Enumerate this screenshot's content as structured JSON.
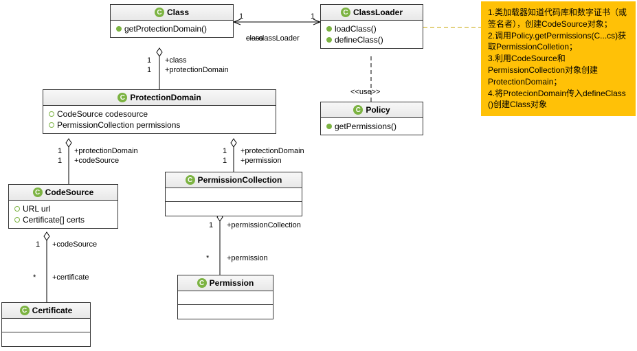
{
  "classes": {
    "class": {
      "name": "Class",
      "ops": [
        "getProtectionDomain()"
      ]
    },
    "classLoader": {
      "name": "ClassLoader",
      "ops": [
        "loadClass()",
        "defineClass()"
      ]
    },
    "protectionDomain": {
      "name": "ProtectionDomain",
      "attrs": [
        "CodeSource codesource",
        "PermissionCollection permissions"
      ]
    },
    "policy": {
      "name": "Policy",
      "ops": [
        "getPermissions()"
      ]
    },
    "codeSource": {
      "name": "CodeSource",
      "attrs": [
        "URL url",
        "Certificate[] certs"
      ]
    },
    "permissionCollection": {
      "name": "PermissionCollection"
    },
    "certificate": {
      "name": "Certificate"
    },
    "permission": {
      "name": "Permission"
    }
  },
  "assoc": {
    "class_cl_left_mult": "1",
    "class_cl_right_mult": "1",
    "class_cl_role": "+classLoader",
    "class_pd_top1": "1",
    "class_pd_top2": "1",
    "class_pd_role1": "+class",
    "class_pd_role2": "+protectionDomain",
    "pd_cs_top1": "1",
    "pd_cs_top2": "1",
    "pd_cs_role1": "+protectionDomain",
    "pd_cs_role2": "+codeSource",
    "pd_pc_top1": "1",
    "pd_pc_top2": "1",
    "pd_pc_role1": "+protectionDomain",
    "pd_pc_role2": "+permission",
    "cs_cert_top": "1",
    "cs_cert_role1": "+codeSource",
    "cs_cert_star": "*",
    "cs_cert_role2": "+certificate",
    "pc_perm_top": "1",
    "pc_perm_role1": "+permissionCollection",
    "pc_perm_star": "*",
    "pc_perm_role2": "+permission",
    "use_label": "<<use>>",
    "class_both": "class"
  },
  "note": {
    "l1": "1.类加载器知道代码库和数字证书（或签名者），创建CodeSource对象；",
    "l2": "2.调用Policy.getPermissions(C...cs)获取PermissionColletion；",
    "l3": "3.利用CodeSource和PermissionCollection对象创建ProtectionDomain；",
    "l4": "4.将ProtecionDomain传入defineClass ()创建Class对象"
  }
}
